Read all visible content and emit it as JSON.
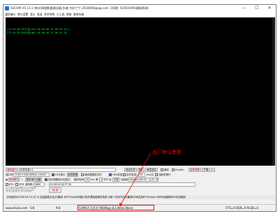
{
  "window": {
    "title": "SSCOM V5.13.1 串口/网络数据调试器,作者:大虾丁丁,2618058@qq.com. QQ群: 52502449(最新版本)",
    "controls": [
      "—",
      "☐",
      "✕"
    ]
  },
  "menu": [
    "通讯端口",
    "串口设置",
    "显示",
    "发送",
    "多字符串",
    "小工具",
    "帮助",
    "联系作者"
  ],
  "console": {
    "lines": [
      "[17:44:02.837]发→◇01 06 00 00 FF 00 02 3A □",
      "[17:44:02.849]收←◆01 06 00 00 FF 00 02 3A"
    ]
  },
  "annotation": {
    "text": "出厂默认参数",
    "color": "#ff0000"
  },
  "toolbar1": {
    "clear_window": "清除窗口",
    "open_file": "打开文件",
    "send_file": "发送文件",
    "stop": "停止",
    "clear_send": "清发送区",
    "topmost": "最前",
    "english": "English",
    "save_params": "保存参数",
    "expand": "扩展",
    "collapse": "—"
  },
  "toolbar2": {
    "port_label": "端口号",
    "port_value": "COM14 USB-SERIAL CH340",
    "hex_display": "HEX显示",
    "save_data": "保存数据",
    "recv_to_file": "接收数据到文件",
    "hex_send": "HEX发送",
    "timed_send": "定时发送:",
    "interval": "50",
    "interval_unit": "ms/次",
    "add_newline": "加回车换行"
  },
  "toolbar3": {
    "close_port": "关闭串口",
    "more_settings": "更多串口设置",
    "timestamp": "加时间戳和分包显示,",
    "timeout_label": "超时时间:",
    "timeout_value": "20",
    "timeout_unit": "ms",
    "byte_label": "第",
    "byte_value": "1",
    "byte_unit": "字节 至",
    "end_label": "末尾",
    "checksum_label": "加校验",
    "checksum_value": "ModbusCRC16",
    "checksum_result": "0C 3A"
  },
  "toolbar4": {
    "rts": "RTS",
    "dtr": "DTR",
    "baud_label": "波特率:",
    "baud_value": "9600",
    "send_data": "01 06 00 00 FF 00"
  },
  "toolbar5": {
    "promo1": "为了更好地发展SSCOM软件",
    "promo2": "请您注册嘉立创F结尾客户",
    "send_button": "发 送"
  },
  "ticker": "【升级到SSCOM V5.13.1】★ 合宙高性价比4G模块 ★RT-Thread中国人的开源免费操作系统 ★新一代WiFi芯片兼容8266支持RT-Thread ★8KM远距离WiFi可自组网",
  "statusbar": {
    "url": "www.daxia.com",
    "s_count": "S:8",
    "r_count": "R:8",
    "port_status": "COM14 已打开  9600bps,8,1,None,None",
    "signals": "CTS=0 DSR=0 RLSD=0"
  },
  "colors": {
    "console_bg": "#000000",
    "console_text": "#00ff40",
    "accent": "#ff0000"
  }
}
